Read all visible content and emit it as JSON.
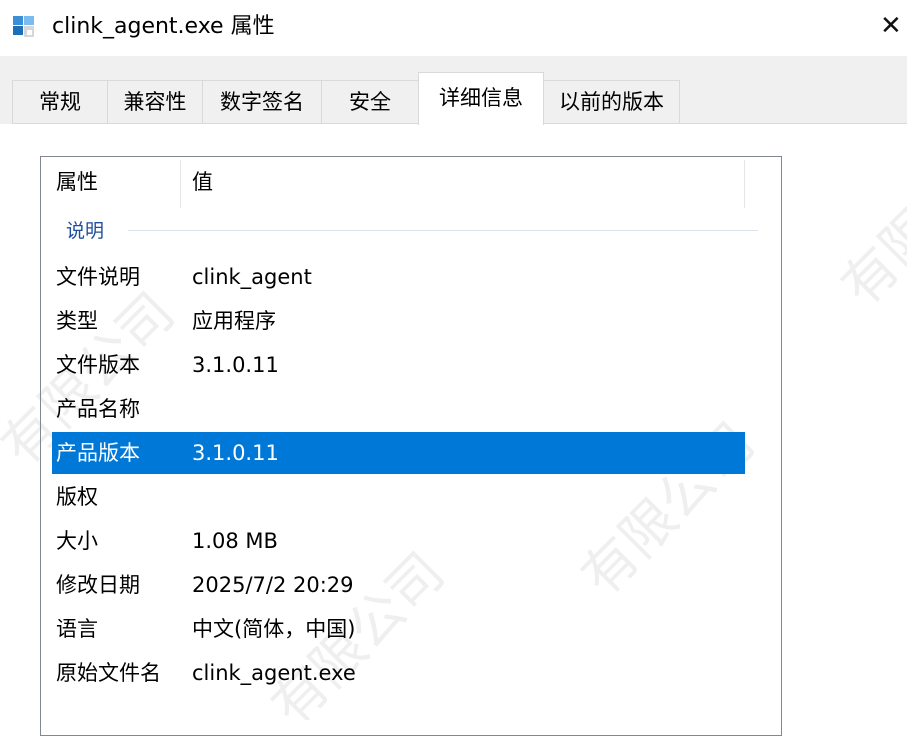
{
  "window": {
    "title": "clink_agent.exe 属性",
    "close_glyph": "✕",
    "icon": "security-shield-icon"
  },
  "tabs": [
    {
      "label": "常规",
      "active": false
    },
    {
      "label": "兼容性",
      "active": false
    },
    {
      "label": "数字签名",
      "active": false
    },
    {
      "label": "安全",
      "active": false
    },
    {
      "label": "详细信息",
      "active": true
    },
    {
      "label": "以前的版本",
      "active": false
    }
  ],
  "details": {
    "header_property": "属性",
    "header_value": "值",
    "group": "说明",
    "rows": [
      {
        "property": "文件说明",
        "value": "clink_agent",
        "selected": false
      },
      {
        "property": "类型",
        "value": "应用程序",
        "selected": false
      },
      {
        "property": "文件版本",
        "value": "3.1.0.11",
        "selected": false
      },
      {
        "property": "产品名称",
        "value": "",
        "selected": false
      },
      {
        "property": "产品版本",
        "value": "3.1.0.11",
        "selected": true
      },
      {
        "property": "版权",
        "value": "",
        "selected": false
      },
      {
        "property": "大小",
        "value": "1.08 MB",
        "selected": false
      },
      {
        "property": "修改日期",
        "value": "2025/7/2 20:29",
        "selected": false
      },
      {
        "property": "语言",
        "value": "中文(简体，中国)",
        "selected": false
      },
      {
        "property": "原始文件名",
        "value": "clink_agent.exe",
        "selected": false
      }
    ]
  },
  "colors": {
    "selection": "#0078d7",
    "group_label": "#1e4e9c",
    "tab_strip": "#f0f0f0"
  }
}
